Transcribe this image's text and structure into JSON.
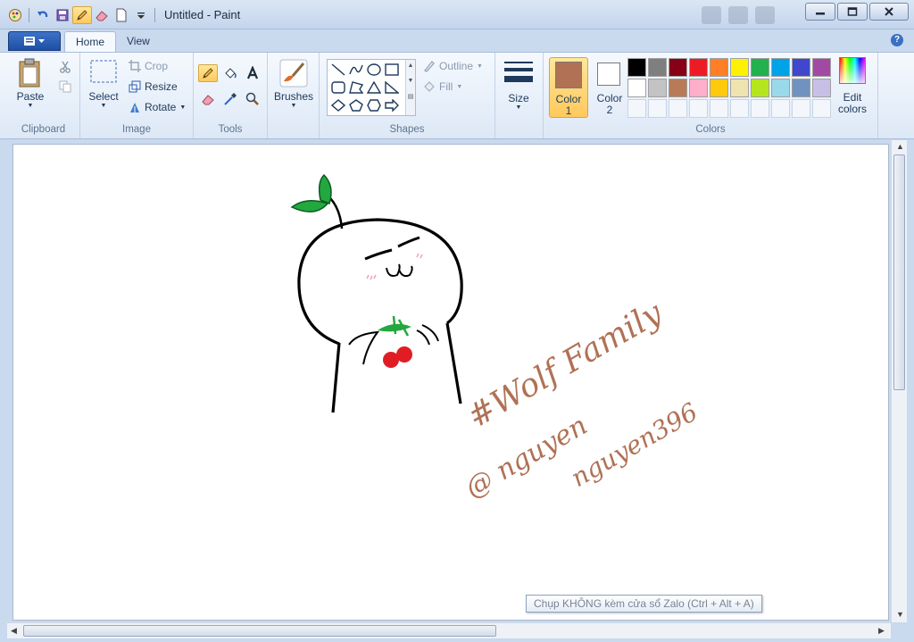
{
  "window": {
    "title": "Untitled - Paint"
  },
  "tabs": {
    "home": "Home",
    "view": "View"
  },
  "clipboard": {
    "paste": "Paste",
    "group": "Clipboard"
  },
  "image": {
    "select": "Select",
    "crop": "Crop",
    "resize": "Resize",
    "rotate": "Rotate",
    "group": "Image"
  },
  "tools": {
    "group": "Tools"
  },
  "brushes": {
    "label": "Brushes"
  },
  "shapes": {
    "outline": "Outline",
    "fill": "Fill",
    "group": "Shapes"
  },
  "size": {
    "label": "Size"
  },
  "colors": {
    "color1_label": "Color",
    "color1_num": "1",
    "color2_label": "Color",
    "color2_num": "2",
    "edit_label": "Edit",
    "edit_label2": "colors",
    "group": "Colors",
    "color1": "#b07154",
    "color2": "#ffffff",
    "palette_row1": [
      "#000000",
      "#7f7f7f",
      "#880015",
      "#ed1c24",
      "#ff7f27",
      "#fff200",
      "#22b14c",
      "#00a2e8",
      "#3f48cc",
      "#a349a4"
    ],
    "palette_row2": [
      "#ffffff",
      "#c3c3c3",
      "#b97a57",
      "#ffaec9",
      "#ffc90e",
      "#efe4b0",
      "#b5e61d",
      "#99d9ea",
      "#7092be",
      "#c8bfe7"
    ]
  },
  "canvas_text": {
    "line1": "#Wolf Family",
    "line2a": "@ nguyen",
    "line2b": "nguyen396"
  },
  "tooltip": {
    "text": "Chụp KHÔNG kèm cửa sổ Zalo (Ctrl + Alt + A)"
  }
}
